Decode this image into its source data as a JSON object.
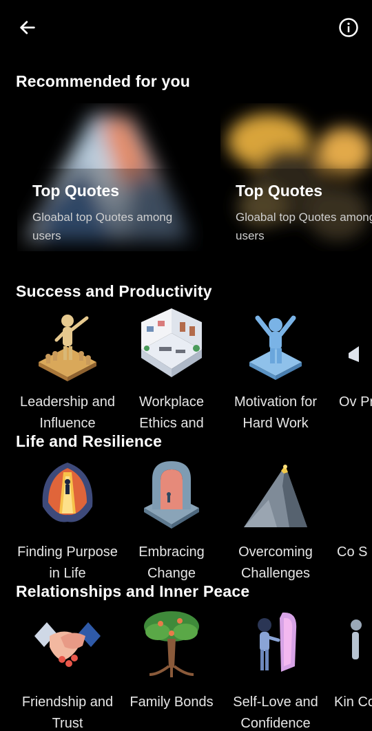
{
  "header": {
    "back_icon": "arrow-left-icon",
    "info_icon": "info-circle-icon"
  },
  "recommended": {
    "title": "Recommended for you",
    "cards": [
      {
        "title": "Top Quotes",
        "subtitle": "Gloabal top Quotes among users"
      },
      {
        "title": "Top Quotes",
        "subtitle": "Gloabal top Quotes among users"
      }
    ]
  },
  "sections": [
    {
      "title": "Success and Productivity",
      "items": [
        {
          "label": "Leadership and Influence",
          "icon": "leader-figure-icon"
        },
        {
          "label": "Workplace Ethics and",
          "icon": "office-room-icon"
        },
        {
          "label": "Motivation for Hard Work",
          "icon": "celebrating-figure-icon"
        },
        {
          "label": "Ov Pro",
          "icon": "partial-item-icon"
        }
      ]
    },
    {
      "title": "Life and Resilience",
      "items": [
        {
          "label": "Finding Purpose in Life",
          "icon": "glowing-path-icon"
        },
        {
          "label": "Embracing Change",
          "icon": "stone-arch-icon"
        },
        {
          "label": "Overcoming Challenges",
          "icon": "mountain-peak-icon"
        },
        {
          "label": "Co S",
          "icon": "partial-item-icon"
        }
      ]
    },
    {
      "title": "Relationships and Inner Peace",
      "items": [
        {
          "label": "Friendship and Trust",
          "icon": "handshake-icon"
        },
        {
          "label": "Family Bonds",
          "icon": "family-tree-icon"
        },
        {
          "label": "Self-Love and Confidence",
          "icon": "mirror-figure-icon"
        },
        {
          "label": "Kin Co",
          "icon": "partial-item-icon"
        }
      ]
    }
  ],
  "colors": {
    "background": "#000000",
    "text": "#ffffff",
    "subtext": "#cfcfcf"
  }
}
